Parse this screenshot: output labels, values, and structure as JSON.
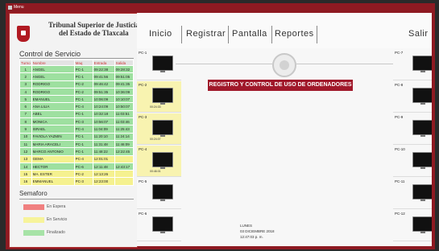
{
  "window": {
    "title": "Menu"
  },
  "institution": {
    "line1": "Tribunal Superior de Justicia",
    "line2": "del Estado de Tlaxcala"
  },
  "control": {
    "title": "Control de Servicio",
    "columns": [
      "Turno",
      "Nombre",
      "Maq",
      "Entrada",
      "Salida"
    ],
    "rows": [
      {
        "num": "1",
        "name": "ANGEL",
        "pc": "PC-1",
        "in": "09:22:38",
        "out": "09:28:32",
        "status": "finalizado"
      },
      {
        "num": "2",
        "name": "ANGEL",
        "pc": "PC-1",
        "in": "09:41:56",
        "out": "09:51:05",
        "status": "finalizado"
      },
      {
        "num": "3",
        "name": "RODRIGO",
        "pc": "PC-2",
        "in": "09:46:42",
        "out": "09:41:35",
        "status": "finalizado"
      },
      {
        "num": "4",
        "name": "RODRIGO",
        "pc": "PC-2",
        "in": "09:51:35",
        "out": "10:36:09",
        "status": "finalizado"
      },
      {
        "num": "5",
        "name": "EMANUEL",
        "pc": "PC-1",
        "in": "10:06:09",
        "out": "10:10:07",
        "status": "finalizado"
      },
      {
        "num": "6",
        "name": "ANA LILIA",
        "pc": "PC-4",
        "in": "10:24:09",
        "out": "10:50:07",
        "status": "finalizado"
      },
      {
        "num": "7",
        "name": "ABEL",
        "pc": "PC-1",
        "in": "10:32:18",
        "out": "11:03:51",
        "status": "finalizado"
      },
      {
        "num": "8",
        "name": "MONICA",
        "pc": "PC-3",
        "in": "10:56:07",
        "out": "11:03:46",
        "status": "finalizado"
      },
      {
        "num": "9",
        "name": "ISRAEL",
        "pc": "PC-4",
        "in": "11:04:09",
        "out": "11:25:43",
        "status": "finalizado"
      },
      {
        "num": "10",
        "name": "FAVIOLA YAZMIN",
        "pc": "PC-1",
        "in": "11:20:10",
        "out": "11:24:14",
        "status": "finalizado"
      },
      {
        "num": "11",
        "name": "MARIA ARACELI",
        "pc": "PC-1",
        "in": "11:31:48",
        "out": "11:46:09",
        "status": "finalizado"
      },
      {
        "num": "12",
        "name": "MARCO ANTONIO",
        "pc": "PC-1",
        "in": "11:48:22",
        "out": "12:22:45",
        "status": "finalizado"
      },
      {
        "num": "13",
        "name": "GEMA",
        "pc": "PC-4",
        "in": "12:01:01",
        "out": "",
        "status": "servicio"
      },
      {
        "num": "14",
        "name": "HECTOR",
        "pc": "PC-6",
        "in": "12:11:48",
        "out": "12:43:17",
        "status": "finalizado"
      },
      {
        "num": "15",
        "name": "MA. ESTER",
        "pc": "PC-2",
        "in": "12:13:26",
        "out": "",
        "status": "servicio"
      },
      {
        "num": "16",
        "name": "EMMANUEL",
        "pc": "PC-3",
        "in": "12:23:00",
        "out": "",
        "status": "servicio"
      }
    ]
  },
  "semaforo": {
    "title": "Semaforo",
    "items": [
      {
        "label": "En Espera",
        "color": "#f08080"
      },
      {
        "label": "En Servicio",
        "color": "#f7f39a"
      },
      {
        "label": "Finalizado",
        "color": "#a7e3a7"
      }
    ]
  },
  "menu": {
    "inicio": "Inicio",
    "registrar": "Registrar",
    "pantalla": "Pantalla",
    "reportes": "Reportes",
    "salir": "Salir"
  },
  "banner": "REGISTRO Y CONTROL DE USO DE ORDENADORES",
  "date": {
    "day": "LUNES",
    "full": "03 DICIEMBRE 2018",
    "time": "12:47:03 p. m."
  },
  "computers_left": [
    {
      "label": "PC-1",
      "state": "free",
      "time": ""
    },
    {
      "label": "PC-2",
      "state": "busy",
      "time": "00:24:33"
    },
    {
      "label": "PC-3",
      "state": "busy",
      "time": "00:24:07"
    },
    {
      "label": "PC-4",
      "state": "busy",
      "time": "00:46:01"
    },
    {
      "label": "PC-5",
      "state": "free",
      "time": ""
    },
    {
      "label": "PC-6",
      "state": "free",
      "time": ""
    }
  ],
  "computers_right": [
    {
      "label": "PC-7",
      "state": "free"
    },
    {
      "label": "PC-8",
      "state": "free"
    },
    {
      "label": "PC-9",
      "state": "free"
    },
    {
      "label": "PC-10",
      "state": "free"
    },
    {
      "label": "PC-11",
      "state": "free"
    },
    {
      "label": "PC-12",
      "state": "free"
    }
  ]
}
